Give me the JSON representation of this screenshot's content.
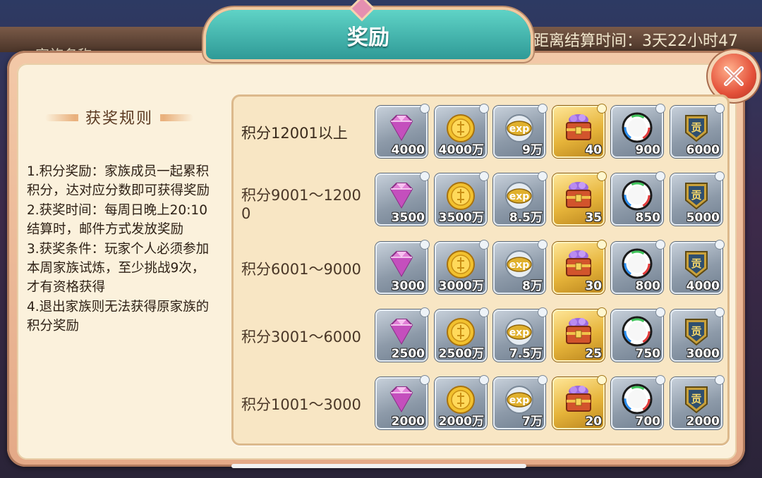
{
  "background": {
    "left_text": "家族名称",
    "right_text": "距离结算时间：3天22小时47"
  },
  "dialog": {
    "title": "奖励",
    "close_icon": "close-x-icon"
  },
  "rules": {
    "header": "获奖规则",
    "lines": [
      "1.积分奖励：家族成员一起累积积分，达对应分数即可获得奖励",
      "2.获奖时间：每周日晚上20:10结算时，邮件方式发放奖励",
      "3.获奖条件：玩家个人必须参加本周家族试炼，至少挑战9次，才有资格获得",
      "4.退出家族则无法获得原家族的积分奖励"
    ]
  },
  "reward_types": [
    "diamond-icon",
    "gold-coin-icon",
    "exp-icon",
    "treasure-chest-icon",
    "rainbow-orb-icon",
    "contribution-badge-icon"
  ],
  "tiers": [
    {
      "label": "积分12001以上",
      "rewards": [
        "4000",
        "4000万",
        "9万",
        "40",
        "900",
        "6000"
      ]
    },
    {
      "label": "积分9001～12000",
      "rewards": [
        "3500",
        "3500万",
        "8.5万",
        "35",
        "850",
        "5000"
      ]
    },
    {
      "label": "积分6001～9000",
      "rewards": [
        "3000",
        "3000万",
        "8万",
        "30",
        "800",
        "4000"
      ]
    },
    {
      "label": "积分3001～6000",
      "rewards": [
        "2500",
        "2500万",
        "7.5万",
        "25",
        "750",
        "3000"
      ]
    },
    {
      "label": "积分1001～3000",
      "rewards": [
        "2000",
        "2000万",
        "7万",
        "20",
        "700",
        "2000"
      ]
    }
  ],
  "colors": {
    "title_teal": "#3fb3ad",
    "close_red": "#e4513a",
    "tile_silver": "#8d9aa9",
    "tile_gold": "#e6b43a"
  }
}
